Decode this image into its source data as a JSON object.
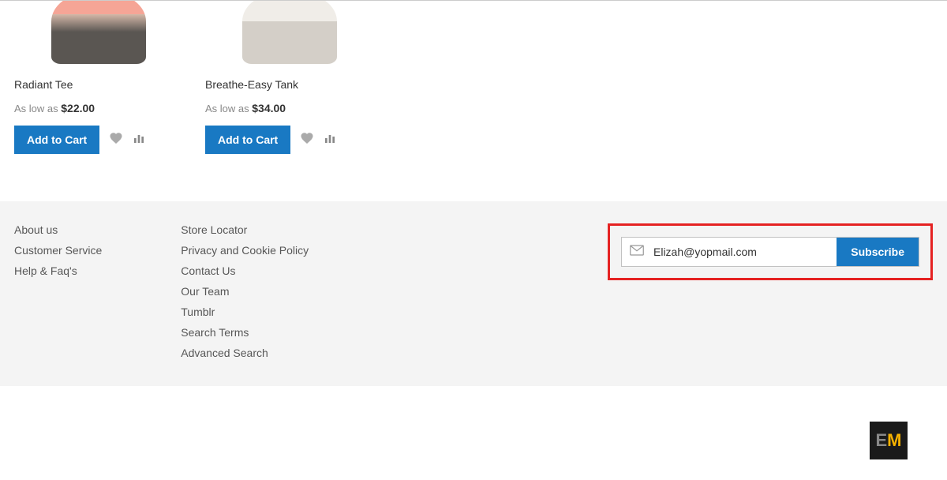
{
  "products": [
    {
      "name": "Radiant Tee",
      "price_prefix": "As low as ",
      "price": "$22.00",
      "add_label": "Add to Cart"
    },
    {
      "name": "Breathe-Easy Tank",
      "price_prefix": "As low as ",
      "price": "$34.00",
      "add_label": "Add to Cart"
    }
  ],
  "footer": {
    "col1": [
      "About us",
      "Customer Service",
      "Help & Faq's"
    ],
    "col2": [
      "Store Locator",
      "Privacy and Cookie Policy",
      "Contact Us",
      "Our Team",
      "Tumblr",
      "Search Terms",
      "Advanced Search"
    ]
  },
  "subscribe": {
    "email_value": "Elizah@yopmail.com",
    "button_label": "Subscribe"
  },
  "badge": {
    "letter1": "E",
    "letter2": "M"
  }
}
